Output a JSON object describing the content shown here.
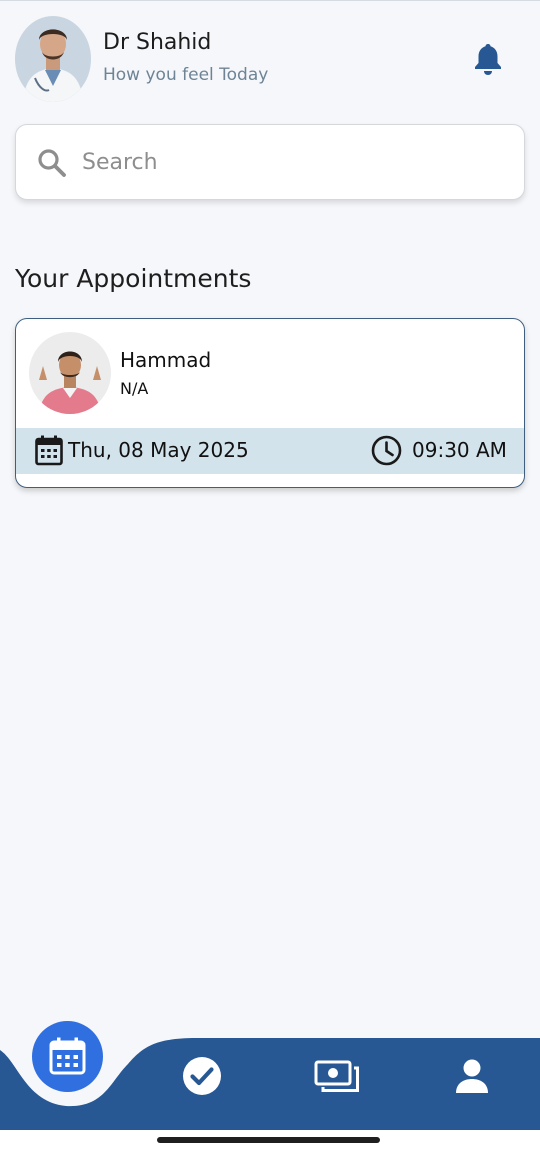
{
  "header": {
    "doctor_name": "Dr Shahid",
    "subtitle": "How you feel Today",
    "notification_icon": "bell-icon"
  },
  "search": {
    "placeholder": "Search",
    "value": "",
    "icon": "search-icon"
  },
  "section_title": "Your Appointments",
  "appointments": [
    {
      "patient_name": "Hammad",
      "patient_detail": "N/A",
      "date": "Thu, 08 May 2025",
      "time": "09:30 AM"
    }
  ],
  "bottom_nav": {
    "items": [
      {
        "icon": "calendar-icon",
        "active": true
      },
      {
        "icon": "check-circle-icon",
        "active": false
      },
      {
        "icon": "cash-icon",
        "active": false
      },
      {
        "icon": "person-icon",
        "active": false
      }
    ]
  },
  "colors": {
    "primary": "#275894",
    "accent": "#2f6fe0",
    "strip": "#d3e3ec",
    "background": "#f5f7fa"
  }
}
